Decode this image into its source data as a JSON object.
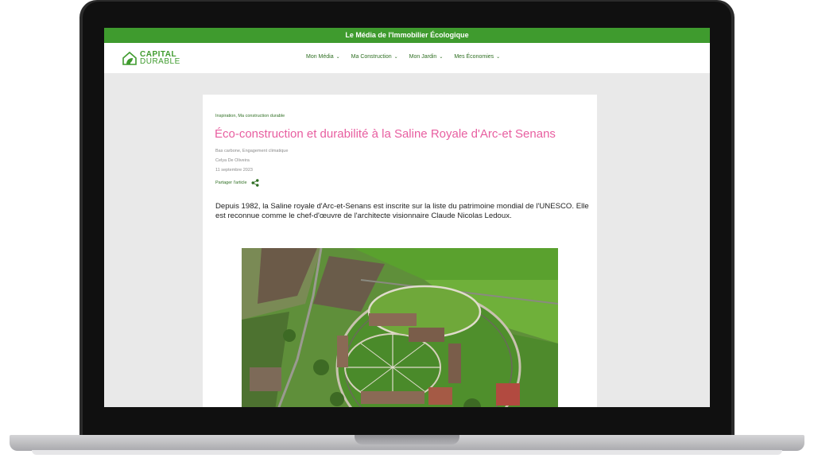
{
  "topbar": {
    "text": "Le Média de l'Immobilier Écologique"
  },
  "logo": {
    "line1": "CAPITAL",
    "line2": "DURABLE"
  },
  "nav": {
    "items": [
      {
        "label": "Mon Média"
      },
      {
        "label": "Ma Construction"
      },
      {
        "label": "Mon Jardin"
      },
      {
        "label": "Mes Économies"
      }
    ]
  },
  "article": {
    "categories": "Inspiration, Ma construction durable",
    "title": "Éco-construction et durabilité à la Saline Royale d'Arc-et Senans",
    "tags": "Bas carbone, Engagement climatique",
    "author": "Celya De Oliveira",
    "date": "11 septembre 2023",
    "share_label": "Partager l'article",
    "lead": "Depuis 1982, la Saline royale d'Arc-et-Senans est inscrite sur la liste du patrimoine mondial de l'UNESCO. Elle est reconnue comme le chef-d'œuvre de l'architecte visionnaire Claude Nicolas Ledoux."
  },
  "colors": {
    "brand_green": "#3f9b2e",
    "title_pink": "#e85ea0",
    "nav_green": "#2f6f23"
  },
  "icons": {
    "share": "share-icon",
    "chevron": "chevron-down-icon"
  }
}
